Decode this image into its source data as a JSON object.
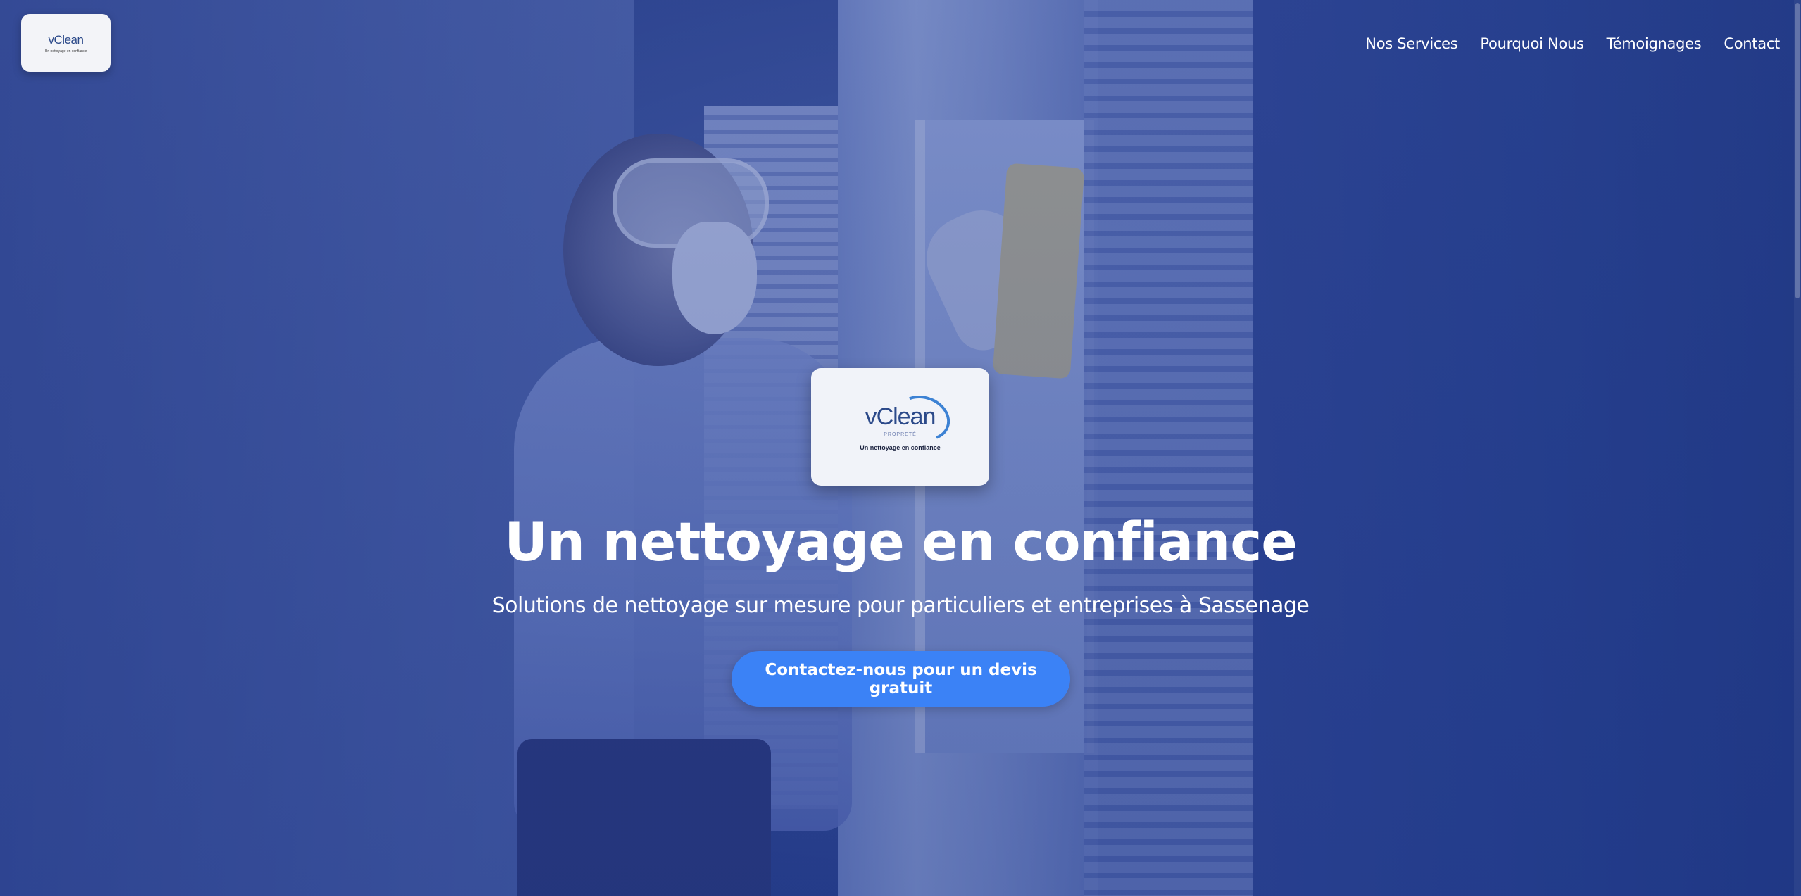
{
  "brand": {
    "name": "vClean",
    "sub": "PROPRETÉ",
    "tagline": "Un nettoyage en confiance"
  },
  "nav": {
    "items": [
      {
        "label": "Nos Services"
      },
      {
        "label": "Pourquoi Nous"
      },
      {
        "label": "Témoignages"
      },
      {
        "label": "Contact"
      }
    ]
  },
  "hero": {
    "title": "Un nettoyage en confiance",
    "subtitle": "Solutions de nettoyage sur mesure pour particuliers et entreprises à Sassenage",
    "cta_label": "Contactez-nous pour un devis gratuit"
  },
  "colors": {
    "overlay": "#2a4196",
    "cta": "#3b82f6",
    "text": "#ffffff",
    "brand": "#2c4a8a"
  }
}
